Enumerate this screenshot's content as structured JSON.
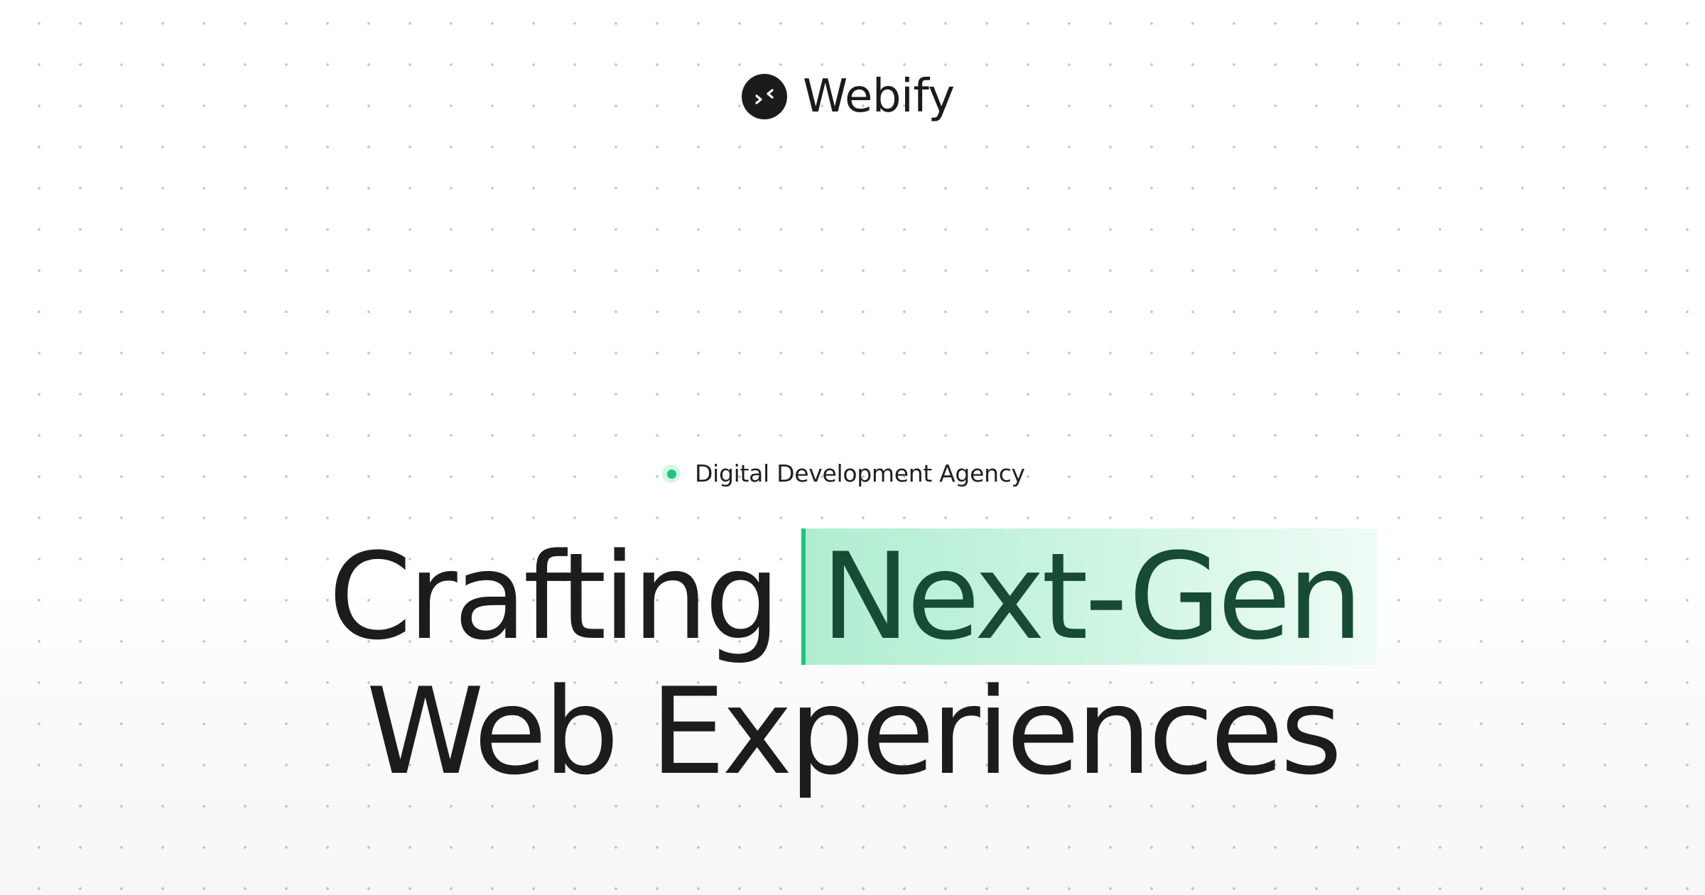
{
  "brand": {
    "name": "Webify",
    "logo_icon": "code-arrows-icon",
    "logo_bg": "#1b1b1b"
  },
  "hero": {
    "tagline": "Digital Development Agency",
    "tagline_icon": "status-dot-icon",
    "tagline_dot_color": "#1fc57e",
    "headline_line1_prefix": "Crafting",
    "headline_highlight": "Next-Gen",
    "headline_line2": "Web Experiences",
    "highlight_text_color": "#174b34",
    "highlight_accent": "#1fc57e"
  }
}
